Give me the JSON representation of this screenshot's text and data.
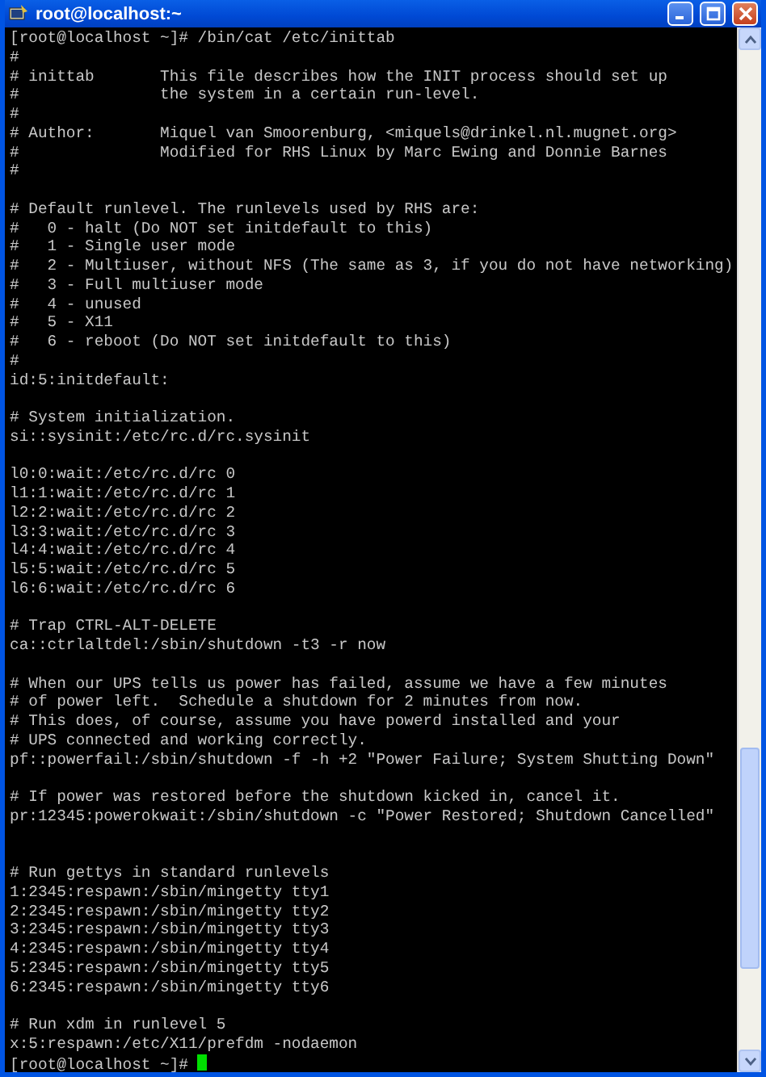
{
  "window": {
    "title": "root@localhost:~"
  },
  "terminal": {
    "lines": [
      {
        "kind": "text",
        "text": "[root@localhost ~]# /bin/cat /etc/inittab"
      },
      {
        "kind": "text",
        "text": "#"
      },
      {
        "kind": "text",
        "text": "# inittab       This file describes how the INIT process should set up"
      },
      {
        "kind": "text",
        "text": "#               the system in a certain run-level."
      },
      {
        "kind": "text",
        "text": "#"
      },
      {
        "kind": "text",
        "text": "# Author:       Miquel van Smoorenburg, <miquels@drinkel.nl.mugnet.org>"
      },
      {
        "kind": "text",
        "text": "#               Modified for RHS Linux by Marc Ewing and Donnie Barnes"
      },
      {
        "kind": "text",
        "text": "#"
      },
      {
        "kind": "blank"
      },
      {
        "kind": "text",
        "text": "# Default runlevel. The runlevels used by RHS are:"
      },
      {
        "kind": "text",
        "text": "#   0 - halt (Do NOT set initdefault to this)"
      },
      {
        "kind": "text",
        "text": "#   1 - Single user mode"
      },
      {
        "kind": "text",
        "text": "#   2 - Multiuser, without NFS (The same as 3, if you do not have networking)"
      },
      {
        "kind": "text",
        "text": "#   3 - Full multiuser mode"
      },
      {
        "kind": "text",
        "text": "#   4 - unused"
      },
      {
        "kind": "text",
        "text": "#   5 - X11"
      },
      {
        "kind": "text",
        "text": "#   6 - reboot (Do NOT set initdefault to this)"
      },
      {
        "kind": "text",
        "text": "#"
      },
      {
        "kind": "text",
        "text": "id:5:initdefault:"
      },
      {
        "kind": "blank"
      },
      {
        "kind": "text",
        "text": "# System initialization."
      },
      {
        "kind": "text",
        "text": "si::sysinit:/etc/rc.d/rc.sysinit"
      },
      {
        "kind": "blank"
      },
      {
        "kind": "text",
        "text": "l0:0:wait:/etc/rc.d/rc 0"
      },
      {
        "kind": "text",
        "text": "l1:1:wait:/etc/rc.d/rc 1"
      },
      {
        "kind": "text",
        "text": "l2:2:wait:/etc/rc.d/rc 2"
      },
      {
        "kind": "text",
        "text": "l3:3:wait:/etc/rc.d/rc 3"
      },
      {
        "kind": "text",
        "text": "l4:4:wait:/etc/rc.d/rc 4"
      },
      {
        "kind": "text",
        "text": "l5:5:wait:/etc/rc.d/rc 5"
      },
      {
        "kind": "text",
        "text": "l6:6:wait:/etc/rc.d/rc 6"
      },
      {
        "kind": "blank"
      },
      {
        "kind": "text",
        "text": "# Trap CTRL-ALT-DELETE"
      },
      {
        "kind": "text",
        "text": "ca::ctrlaltdel:/sbin/shutdown -t3 -r now"
      },
      {
        "kind": "blank"
      },
      {
        "kind": "text",
        "text": "# When our UPS tells us power has failed, assume we have a few minutes"
      },
      {
        "kind": "text",
        "text": "# of power left.  Schedule a shutdown for 2 minutes from now."
      },
      {
        "kind": "text",
        "text": "# This does, of course, assume you have powerd installed and your"
      },
      {
        "kind": "text",
        "text": "# UPS connected and working correctly."
      },
      {
        "kind": "text",
        "text": "pf::powerfail:/sbin/shutdown -f -h +2 \"Power Failure; System Shutting Down\""
      },
      {
        "kind": "blank"
      },
      {
        "kind": "text",
        "text": "# If power was restored before the shutdown kicked in, cancel it."
      },
      {
        "kind": "text",
        "text": "pr:12345:powerokwait:/sbin/shutdown -c \"Power Restored; Shutdown Cancelled\""
      },
      {
        "kind": "blank"
      },
      {
        "kind": "blank"
      },
      {
        "kind": "text",
        "text": "# Run gettys in standard runlevels"
      },
      {
        "kind": "text",
        "text": "1:2345:respawn:/sbin/mingetty tty1"
      },
      {
        "kind": "text",
        "text": "2:2345:respawn:/sbin/mingetty tty2"
      },
      {
        "kind": "text",
        "text": "3:2345:respawn:/sbin/mingetty tty3"
      },
      {
        "kind": "text",
        "text": "4:2345:respawn:/sbin/mingetty tty4"
      },
      {
        "kind": "text",
        "text": "5:2345:respawn:/sbin/mingetty tty5"
      },
      {
        "kind": "text",
        "text": "6:2345:respawn:/sbin/mingetty tty6"
      },
      {
        "kind": "blank"
      },
      {
        "kind": "text",
        "text": "# Run xdm in runlevel 5"
      },
      {
        "kind": "text",
        "text": "x:5:respawn:/etc/X11/prefdm -nodaemon"
      },
      {
        "kind": "prompt",
        "text": "[root@localhost ~]#"
      }
    ]
  }
}
